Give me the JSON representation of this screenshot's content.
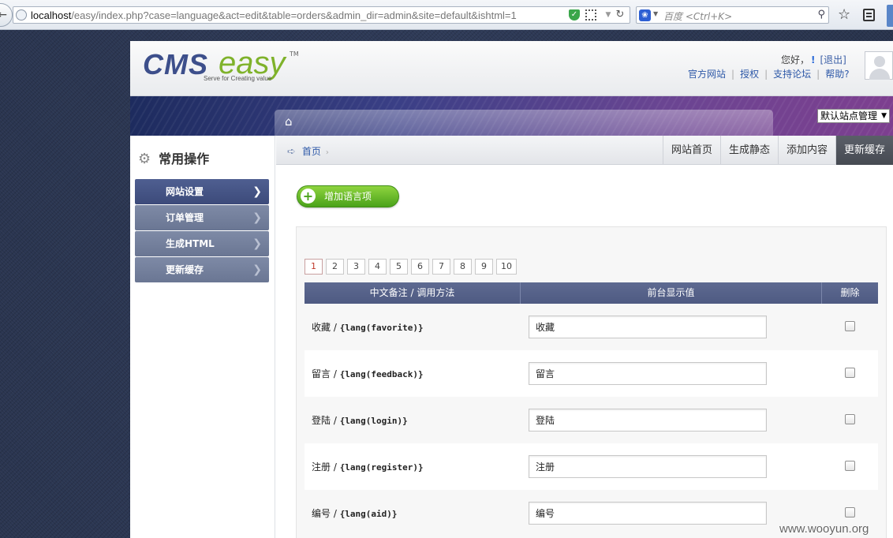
{
  "browser": {
    "url_host": "localhost",
    "url_path": "/easy/index.php?case=language&act=edit&table=orders&admin_dir=admin&site=default&ishtml=1",
    "search_placeholder": "百度 <Ctrl+K>",
    "icons": [
      "back-arrow-icon",
      "globe-icon",
      "shield-icon",
      "qr-code-icon",
      "reload-icon",
      "baidu-paw-icon",
      "search-icon",
      "bookmark-star-icon",
      "reader-icon"
    ]
  },
  "header": {
    "logo_main": "CMS",
    "logo_accent": "easy",
    "logo_tm": "TM",
    "logo_tagline": "Serve for Creating value",
    "greeting": "您好，",
    "greeting_mark": "!",
    "logout": "[退出]",
    "links": [
      "官方网站",
      "授权",
      "支持论坛",
      "帮助?"
    ]
  },
  "banner": {
    "site_select": "默认站点管理"
  },
  "sidebar": {
    "title": "常用操作",
    "items": [
      {
        "label": "网站设置",
        "active": true
      },
      {
        "label": "订单管理",
        "active": false
      },
      {
        "label": "生成HTML",
        "active": false
      },
      {
        "label": "更新缓存",
        "active": false
      }
    ]
  },
  "breadcrumb": {
    "home": "首页"
  },
  "quick_buttons": [
    "网站首页",
    "生成静态",
    "添加内容",
    "更新缓存"
  ],
  "add_button": "增加语言项",
  "pagination": {
    "current": 1,
    "pages": [
      "1",
      "2",
      "3",
      "4",
      "5",
      "6",
      "7",
      "8",
      "9",
      "10"
    ]
  },
  "table": {
    "headers": [
      "中文备注 / 调用方法",
      "前台显示值",
      "删除"
    ],
    "rows": [
      {
        "note": "收藏",
        "code": "{lang(favorite)}",
        "value": "收藏"
      },
      {
        "note": "留言",
        "code": "{lang(feedback)}",
        "value": "留言"
      },
      {
        "note": "登陆",
        "code": "{lang(login)}",
        "value": "登陆"
      },
      {
        "note": "注册",
        "code": "{lang(register)}",
        "value": "注册"
      },
      {
        "note": "编号",
        "code": "{lang(aid)}",
        "value": "编号"
      }
    ]
  },
  "watermark": "www.wooyun.org",
  "colors": {
    "accent": "#4e5a82",
    "link": "#2e59a8",
    "add_green": "#4aa21a",
    "logo_blue": "#3d4f8b",
    "logo_green": "#7fb22b"
  }
}
